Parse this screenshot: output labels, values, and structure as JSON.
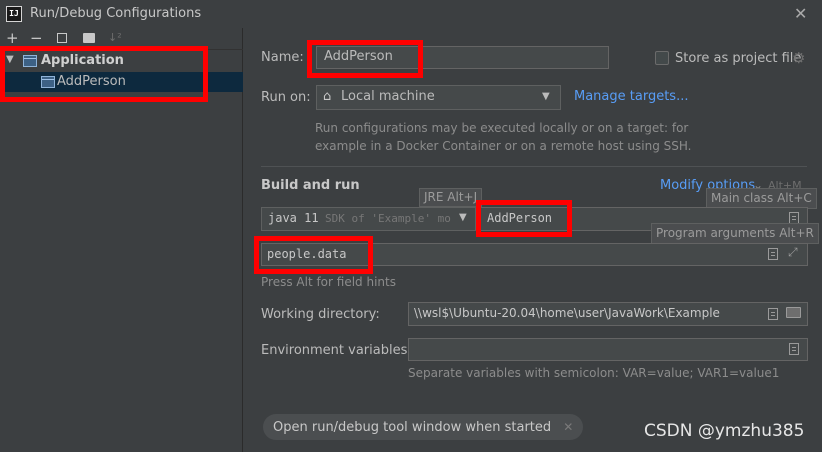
{
  "window": {
    "title": "Run/Debug Configurations",
    "app_icon_text": "IJ"
  },
  "tree": {
    "root_label": "Application",
    "child_label": "AddPerson"
  },
  "form": {
    "name_label": "Name:",
    "name_value": "AddPerson",
    "store_label": "Store as project file",
    "run_on_label": "Run on:",
    "run_on_value": "Local machine",
    "manage_targets": "Manage targets...",
    "run_on_hint_line1": "Run configurations may be executed locally or on a target: for",
    "run_on_hint_line2": "example in a Docker Container or on a remote host using SSH.",
    "build_and_run": "Build and run",
    "modify_options": "Modify options",
    "modify_shortcut": "Alt+M",
    "jre_tooltip": "JRE Alt+J",
    "sdk_prefix": "java 11",
    "sdk_suffix": "SDK of 'Example' mo",
    "main_class_value": "AddPerson",
    "main_class_tooltip": "Main class Alt+C",
    "program_args_value": "people.data",
    "program_args_tooltip": "Program arguments Alt+R",
    "press_alt_hint": "Press Alt for field hints",
    "working_dir_label": "Working directory:",
    "working_dir_value": "\\\\wsl$\\Ubuntu-20.04\\home\\user\\JavaWork\\Example",
    "env_label": "Environment variables:",
    "env_value": "",
    "env_hint": "Separate variables with semicolon: VAR=value; VAR1=value1",
    "open_tool_window": "Open run/debug tool window when started"
  },
  "watermark": "CSDN @ymzhu385",
  "colors": {
    "highlight": "#ff0000",
    "link": "#589df6",
    "selection": "#0d293e"
  }
}
